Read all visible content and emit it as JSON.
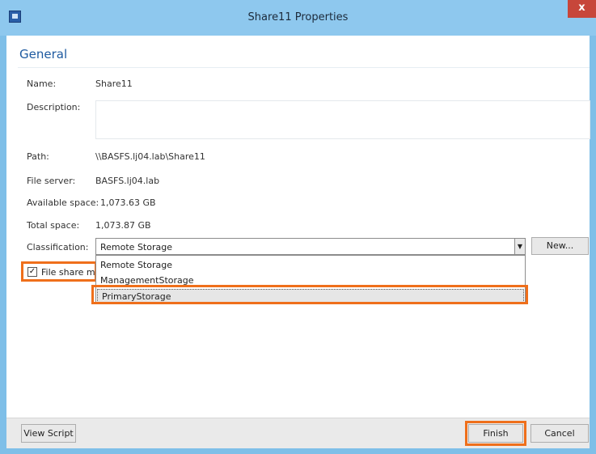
{
  "window": {
    "title": "Share11 Properties",
    "close_symbol": "x"
  },
  "section": {
    "title": "General"
  },
  "fields": {
    "name_label": "Name:",
    "name_value": "Share11",
    "description_label": "Description:",
    "description_value": "",
    "path_label": "Path:",
    "path_value": "\\\\BASFS.lj04.lab\\Share11",
    "file_server_label": "File server:",
    "file_server_value": "BASFS.lj04.lab",
    "available_space_label": "Available space:",
    "available_space_value": "1,073.63 GB",
    "total_space_label": "Total space:",
    "total_space_value": "1,073.87 GB",
    "classification_label": "Classification:",
    "classification_value": "Remote Storage",
    "new_button": "New..."
  },
  "classification_options": [
    "Remote Storage",
    "ManagementStorage",
    "PrimaryStorage"
  ],
  "checkbox": {
    "label": "File share ma",
    "checked": true,
    "check_symbol": "✓"
  },
  "footer": {
    "view_script": "View Script",
    "finish": "Finish",
    "cancel": "Cancel"
  },
  "colors": {
    "accent": "#1e5aa0",
    "highlight": "#ef6f1b",
    "titlebar": "#8ec8ee",
    "close": "#c7463a"
  },
  "icons": {
    "dropdown_arrow": "▼"
  }
}
